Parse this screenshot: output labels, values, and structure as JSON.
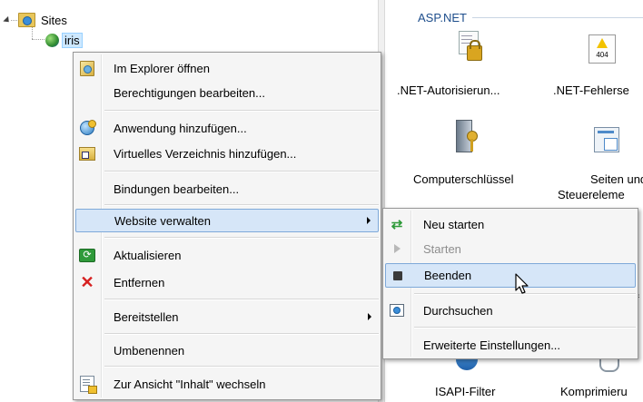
{
  "tree": {
    "sites_label": "Sites",
    "site_label": "iris"
  },
  "features": {
    "group_title": "ASP.NET",
    "items": [
      {
        "label": ".NET-Autorisierun...",
        "icon": "lock-document-icon"
      },
      {
        "label": ".NET-Fehlerse",
        "icon": "error-404-icon"
      },
      {
        "label": "Computerschlüssel",
        "icon": "server-key-icon"
      },
      {
        "label": "Seiten und",
        "label2": "Steuereleme",
        "icon": "pages-controls-icon"
      },
      {
        "label": "ISAPI-Filter",
        "icon": "globe-filter-icon"
      },
      {
        "label": "Komprimieru",
        "icon": "compression-icon"
      }
    ],
    "partial_glyph": "f"
  },
  "context_menu": {
    "items": [
      {
        "label": "Im Explorer öffnen",
        "icon": "explorer-icon"
      },
      {
        "label": "Berechtigungen bearbeiten..."
      },
      {
        "label": "Anwendung hinzufügen...",
        "icon": "add-application-icon"
      },
      {
        "label": "Virtuelles Verzeichnis hinzufügen...",
        "icon": "add-virtual-directory-icon"
      },
      {
        "label": "Bindungen bearbeiten..."
      },
      {
        "label": "Website verwalten",
        "submenu": true
      },
      {
        "label": "Aktualisieren",
        "icon": "refresh-icon"
      },
      {
        "label": "Entfernen",
        "icon": "remove-icon"
      },
      {
        "label": "Bereitstellen",
        "submenu": true
      },
      {
        "label": "Umbenennen"
      },
      {
        "label": "Zur Ansicht \"Inhalt\" wechseln",
        "icon": "content-view-icon"
      }
    ]
  },
  "submenu": {
    "items": [
      {
        "label": "Neu starten",
        "icon": "restart-icon"
      },
      {
        "label": "Starten",
        "icon": "start-icon",
        "disabled": true
      },
      {
        "label": "Beenden",
        "icon": "stop-icon"
      },
      {
        "label": "Durchsuchen",
        "icon": "browse-icon"
      },
      {
        "label": "Erweiterte Einstellungen..."
      }
    ]
  },
  "colors": {
    "highlight_bg": "#d6e6f8",
    "highlight_border": "#7ea9d9",
    "group_title": "#1e4e8c",
    "remove_red": "#d62020"
  }
}
